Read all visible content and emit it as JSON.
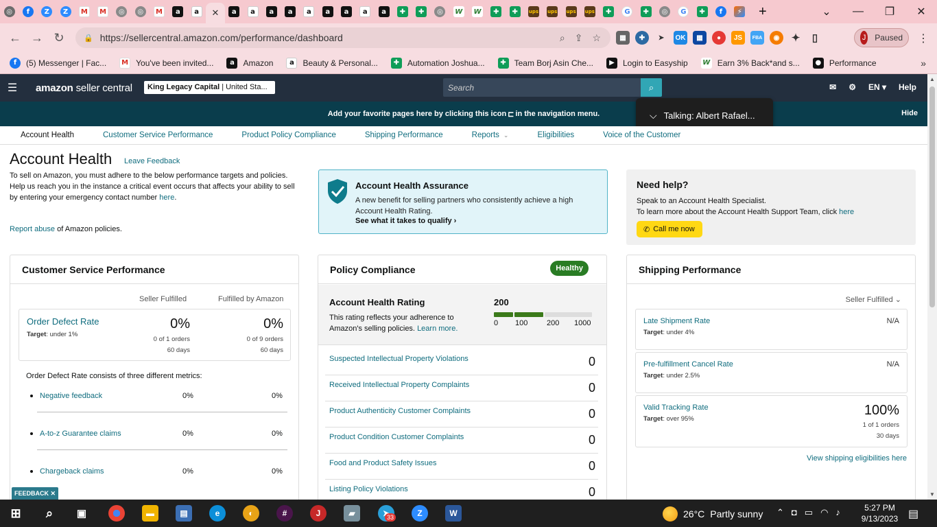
{
  "browser": {
    "address": "https://sellercentral.amazon.com/performance/dashboard",
    "profile_initial": "J",
    "profile_status": "Paused",
    "tab_icons": [
      "chrome-icon",
      "facebook-icon",
      "zoom-icon",
      "zoom-icon",
      "gmail-icon",
      "gmail-icon",
      "globe-icon",
      "globe-icon",
      "gmail-icon",
      "amazon-icon",
      "amazon-icon",
      "close-icon",
      "amazon-icon",
      "amazon-icon",
      "amazon-icon",
      "amazon-icon",
      "amazon-icon",
      "amazon-icon",
      "amazon-icon",
      "amazon-icon",
      "amazon-icon",
      "sheets-icon",
      "sheets-icon",
      "globe-icon",
      "wish-icon",
      "wish-icon",
      "sheets-icon",
      "sheets-icon",
      "ups-icon",
      "ups-icon",
      "ups-icon",
      "ups-icon",
      "sheets-icon",
      "google-icon",
      "sheets-icon",
      "globe-icon",
      "google-icon",
      "sheets-icon",
      "facebook-icon",
      "multi-icon"
    ],
    "bookmarks": [
      {
        "label": "(5) Messenger | Fac...",
        "icon": "facebook-icon"
      },
      {
        "label": "You've been invited...",
        "icon": "gmail-icon"
      },
      {
        "label": "Amazon",
        "icon": "amazon-icon"
      },
      {
        "label": "Beauty & Personal...",
        "icon": "amazon-icon"
      },
      {
        "label": "Automation Joshua...",
        "icon": "sheets-icon"
      },
      {
        "label": "Team Borj Asin Che...",
        "icon": "sheets-icon"
      },
      {
        "label": "Login to Easyship",
        "icon": "easyship-icon"
      },
      {
        "label": "Earn 3% Back*and s...",
        "icon": "wish-icon"
      },
      {
        "label": "Performance",
        "icon": "github-icon"
      }
    ]
  },
  "header": {
    "brand_prefix": "amazon",
    "brand_suffix": " seller central",
    "store_name": "King Legacy Capital",
    "store_region": " | United Sta...",
    "search_placeholder": "Search",
    "language": "EN",
    "help": "Help",
    "favorites_text": "Add your favorite pages here by clicking this icon",
    "favorites_text2": " in the navigation menu.",
    "hide": "Hide"
  },
  "talking_popup": {
    "text": "Talking: Albert Rafael..."
  },
  "subnav": [
    "Account Health",
    "Customer Service Performance",
    "Product Policy Compliance",
    "Shipping Performance",
    "Reports",
    "Eligibilities",
    "Voice of the Customer"
  ],
  "page": {
    "title": "Account Health",
    "leave_feedback": "Leave Feedback",
    "intro1": "To sell on Amazon, you must adhere to the below performance targets and policies.",
    "intro2": "Help us reach you in the instance a critical event occurs that affects your ability to sell by entering your emergency contact number",
    "intro2_link": "here",
    "report_abuse_link": "Report abuse",
    "report_abuse_rest": " of Amazon policies.",
    "feedback_tab": "FEEDBACK ✕"
  },
  "assurance": {
    "heading": "Account Health Assurance",
    "desc": "A new benefit for selling partners who consistently achieve a high Account Health Rating.",
    "qualify": "See what it takes to qualify"
  },
  "help": {
    "heading": "Need help?",
    "line1": "Speak to an Account Health Specialist.",
    "line2": "To learn more about the Account Health Support Team, click",
    "line2_link": "here",
    "call_button": "Call me now"
  },
  "customer_service": {
    "heading": "Customer Service Performance",
    "col1": "Seller Fulfilled",
    "col2": "Fulfilled by Amazon",
    "odr_name": "Order Defect Rate",
    "odr_target_label": "Target",
    "odr_target": ": under 1%",
    "sf_pct": "0%",
    "sf_orders": "0 of 1 orders",
    "sf_days": "60 days",
    "fba_pct": "0%",
    "fba_orders": "0 of 9 orders",
    "fba_days": "60 days",
    "odr_note": "Order Defect Rate consists of three different metrics:",
    "metrics": [
      {
        "name": "Negative feedback",
        "sf": "0%",
        "fba": "0%"
      },
      {
        "name": "A-to-z Guarantee claims",
        "sf": "0%",
        "fba": "0%"
      },
      {
        "name": "Chargeback claims",
        "sf": "0%",
        "fba": "0%"
      }
    ]
  },
  "policy": {
    "heading": "Policy Compliance",
    "status": "Healthy",
    "ahr_heading": "Account Health Rating",
    "ahr_desc": "This rating reflects your adherence to Amazon's selling policies.",
    "ahr_learn": "Learn more.",
    "score": "200",
    "score_fraction": 0.5,
    "ticks": [
      "0",
      "100",
      "200",
      "1000"
    ],
    "rows": [
      {
        "label": "Suspected Intellectual Property Violations",
        "value": "0"
      },
      {
        "label": "Received Intellectual Property Complaints",
        "value": "0"
      },
      {
        "label": "Product Authenticity Customer Complaints",
        "value": "0"
      },
      {
        "label": "Product Condition Customer Complaints",
        "value": "0"
      },
      {
        "label": "Food and Product Safety Issues",
        "value": "0"
      },
      {
        "label": "Listing Policy Violations",
        "value": "0"
      }
    ]
  },
  "shipping": {
    "heading": "Shipping Performance",
    "selector": "Seller Fulfilled",
    "rows": [
      {
        "label": "Late Shipment Rate",
        "target_label": "Target",
        "target": ": under 4%",
        "value": "N/A"
      },
      {
        "label": "Pre-fulfillment Cancel Rate",
        "target_label": "Target",
        "target": ": under 2.5%",
        "value": "N/A"
      }
    ],
    "tracking": {
      "label": "Valid Tracking Rate",
      "target_label": "Target",
      "target": ": over 95%",
      "value": "100%",
      "orders": "1 of 1 orders",
      "days": "30 days"
    },
    "eligibility_link": "View shipping eligibilities here"
  },
  "taskbar": {
    "weather_temp": "26°C",
    "weather_text": "Partly sunny",
    "time": "5:27 PM",
    "date": "9/13/2023",
    "telegram_badge": "33"
  },
  "colors": {
    "amazon_dark": "#232f3e",
    "teal_bar": "#0a3d4c",
    "healthy_green": "#297c24",
    "call_yellow": "#ffd814",
    "tab_pink": "#f6c9cf"
  }
}
